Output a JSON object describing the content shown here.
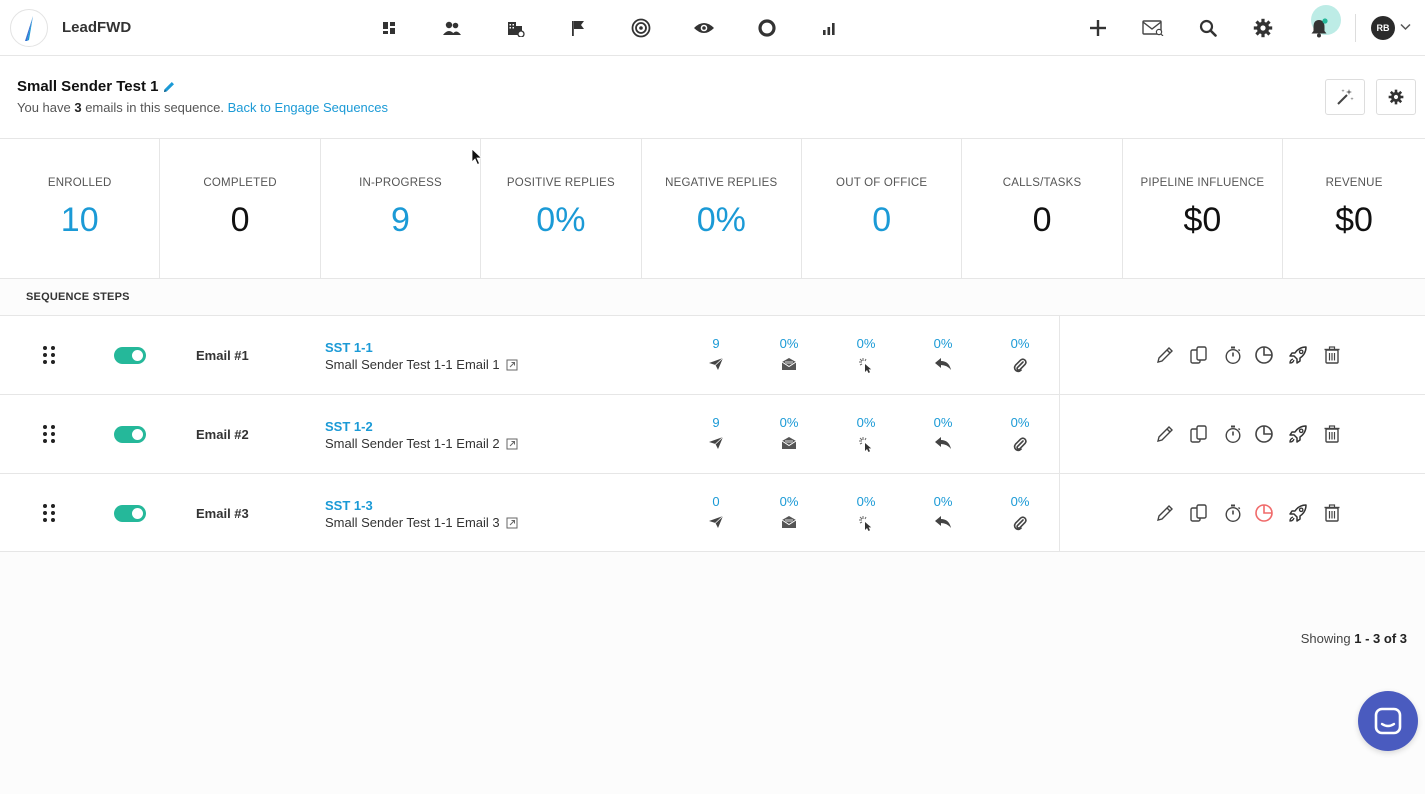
{
  "app": {
    "name": "LeadFWD"
  },
  "topnav": {
    "icons": [
      "dashboard-icon",
      "people-icon",
      "buildings-icon",
      "flag-icon",
      "target-icon",
      "eye-icon",
      "circle-icon",
      "bar-chart-icon"
    ],
    "right_icons": [
      "plus-icon",
      "mail-icon",
      "search-icon",
      "gear-icon",
      "bell-icon"
    ],
    "avatar_initials": "RB"
  },
  "header": {
    "title": "Small Sender Test 1",
    "subtitle_prefix": "You have ",
    "email_count": "3",
    "subtitle_suffix": " emails in this sequence. ",
    "back_link": "Back to Engage Sequences"
  },
  "stats": [
    {
      "label": "ENROLLED",
      "value": "10",
      "highlight": true
    },
    {
      "label": "COMPLETED",
      "value": "0",
      "highlight": false
    },
    {
      "label": "IN-PROGRESS",
      "value": "9",
      "highlight": true
    },
    {
      "label": "POSITIVE REPLIES",
      "value": "0%",
      "highlight": true
    },
    {
      "label": "NEGATIVE REPLIES",
      "value": "0%",
      "highlight": true
    },
    {
      "label": "OUT OF OFFICE",
      "value": "0",
      "highlight": true
    },
    {
      "label": "CALLS/TASKS",
      "value": "0",
      "highlight": false
    },
    {
      "label": "PIPELINE INFLUENCE",
      "value": "$0",
      "highlight": false
    },
    {
      "label": "REVENUE",
      "value": "$0",
      "highlight": false
    }
  ],
  "section": {
    "title": "SEQUENCE STEPS"
  },
  "steps": [
    {
      "label": "Email #1",
      "code": "SST 1-1",
      "name": "Small Sender Test 1-1 Email 1",
      "enabled": true,
      "sent": "9",
      "opened": "0%",
      "clicked": "0%",
      "replied": "0%",
      "bounced": "0%",
      "analytics_alert": false
    },
    {
      "label": "Email #2",
      "code": "SST 1-2",
      "name": "Small Sender Test 1-1 Email 2",
      "enabled": true,
      "sent": "9",
      "opened": "0%",
      "clicked": "0%",
      "replied": "0%",
      "bounced": "0%",
      "analytics_alert": false
    },
    {
      "label": "Email #3",
      "code": "SST 1-3",
      "name": "Small Sender Test 1-1 Email 3",
      "enabled": true,
      "sent": "0",
      "opened": "0%",
      "clicked": "0%",
      "replied": "0%",
      "bounced": "0%",
      "analytics_alert": true
    }
  ],
  "footer": {
    "showing_prefix": "Showing ",
    "showing_range": "1 - 3 of 3"
  },
  "colors": {
    "accent": "#1b9ad6",
    "toggle_on": "#25b89a",
    "alert": "#f06a6a",
    "chat": "#4a5bbf"
  }
}
